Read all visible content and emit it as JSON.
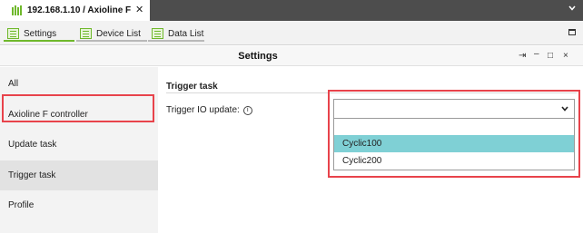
{
  "document_tab": {
    "title": "192.168.1.10 / Axioline F",
    "close_glyph": "✕"
  },
  "toolbar": {
    "items": [
      {
        "label": "Settings",
        "icon": "settings-icon"
      },
      {
        "label": "Device List",
        "icon": "device-list-icon"
      },
      {
        "label": "Data List",
        "icon": "data-list-icon"
      }
    ]
  },
  "panel": {
    "title": "Settings",
    "controls": {
      "pin": "⇥",
      "minimize": "–",
      "restore": "□",
      "close": "×"
    }
  },
  "sidebar": {
    "items": [
      {
        "label": "All"
      },
      {
        "label": "Axioline F controller"
      },
      {
        "label": "Update task"
      },
      {
        "label": "Trigger task",
        "selected": true
      },
      {
        "label": "Profile"
      }
    ]
  },
  "content": {
    "section_title": "Trigger task",
    "field_label": "Trigger IO update:",
    "info_glyph": "i",
    "select": {
      "value": "",
      "options": [
        "",
        "Cyclic100",
        "Cyclic200"
      ],
      "highlighted_option": "Cyclic100"
    }
  },
  "colors": {
    "accent_green": "#6fb82c",
    "highlight_red": "#e8434b",
    "option_highlight": "#7fd0d5",
    "tabbar_dark": "#4d4d4d"
  }
}
